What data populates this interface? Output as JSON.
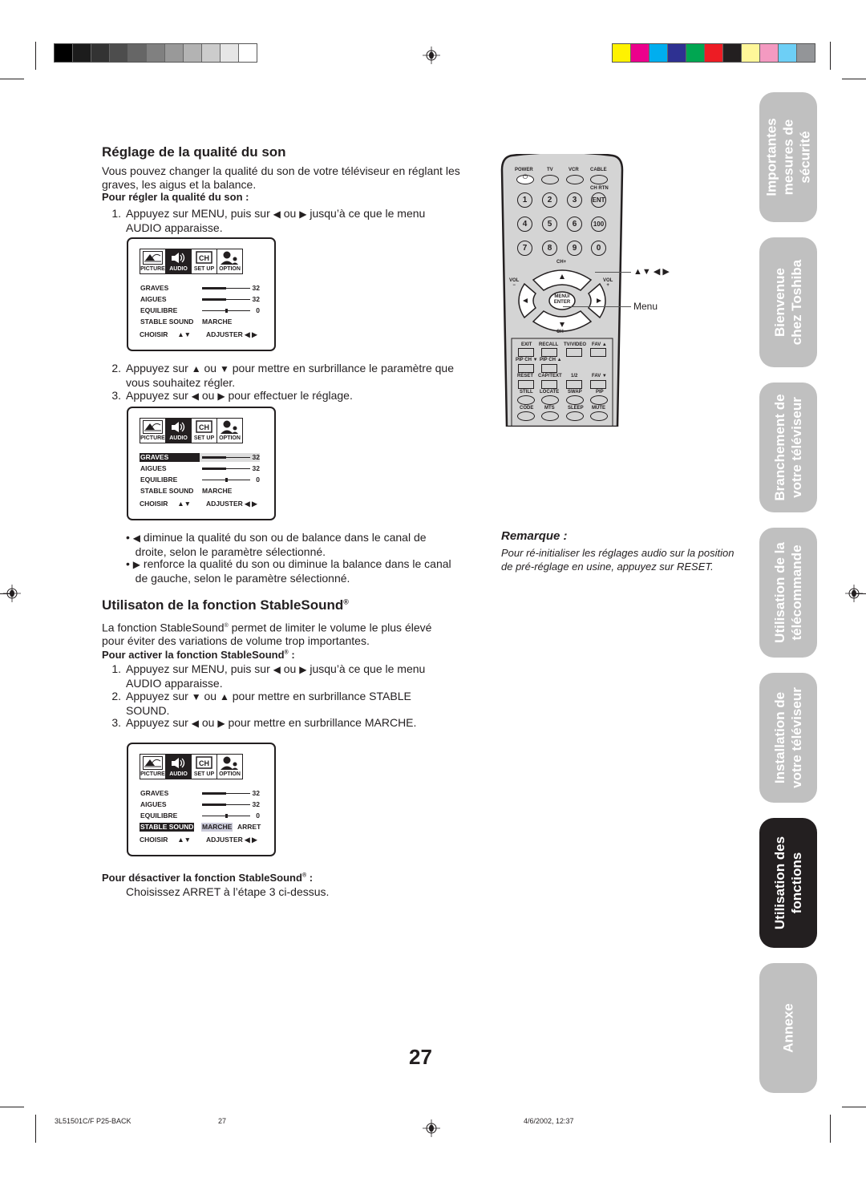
{
  "registration": {
    "grayscale": [
      "#000000",
      "#1c1c1c",
      "#333333",
      "#4d4d4d",
      "#666666",
      "#808080",
      "#999999",
      "#b3b3b3",
      "#cccccc",
      "#e6e6e6",
      "#ffffff"
    ],
    "colors": [
      "#fff200",
      "#ec008c",
      "#00aeef",
      "#2e3192",
      "#00a651",
      "#ed1c24",
      "#231f20",
      "#fff799",
      "#f49ac1",
      "#6dcff6",
      "#939598"
    ]
  },
  "section1": {
    "title": "Réglage de la qualité du son",
    "intro": "Vous pouvez changer la qualité du son de votre téléviseur  en réglant les graves, les aigus et la balance.",
    "subhead": "Pour régler la qualité du son :",
    "step1": {
      "num": "1.",
      "a": "Appuyez sur MENU, puis sur",
      "ou": "ou",
      "b": "jusqu’à ce que le menu",
      "c": "AUDIO apparaisse."
    },
    "step2": {
      "num": "2.",
      "a": "Appuyez sur",
      "ou": "ou",
      "b": "pour mettre en surbrillance le paramètre que",
      "c": "vous souhaitez régler."
    },
    "step3": {
      "num": "3.",
      "a": "Appuyez sur",
      "ou": "ou",
      "b": "pour effectuer le réglage."
    },
    "bullet1": {
      "a": "diminue la qualité du son ou de balance dans le canal de",
      "b": "droite, selon le paramètre sélectionné."
    },
    "bullet2": {
      "a": "renforce la qualité du son ou diminue la balance dans le canal",
      "b": "de gauche, selon le paramètre sélectionné."
    }
  },
  "section2": {
    "title": "Utilisaton de la fonction StableSound",
    "reg_mark": "®",
    "intro_a": "La fonction StableSound",
    "intro_b": " permet de limiter le volume le plus élevé",
    "intro_c": "pour éviter des variations de volume trop importantes.",
    "subhead": "Pour activer la fonction StableSound",
    "subhead_colon": " :",
    "step1": {
      "num": "1.",
      "a": "Appuyez sur MENU, puis sur",
      "ou": "ou",
      "b": "jusqu’à ce que le menu",
      "c": "AUDIO apparaisse."
    },
    "step2": {
      "num": "2.",
      "a": "Appuyez sur ",
      "ou": "ou",
      "b": "pour mettre en surbrillance STABLE",
      "c": "SOUND."
    },
    "step3": {
      "num": "3.",
      "a": "Appuyez sur",
      "ou": "ou",
      "b": "pour mettre en surbrillance MARCHE."
    },
    "deact_head": "Pour désactiver la fonction StableSound",
    "deact_colon": " :",
    "deact_text": "Choisissez ARRET à l’étape 3 ci-dessus."
  },
  "osd": {
    "tabs": [
      "PICTURE",
      "AUDIO",
      "SET UP",
      "OPTION"
    ],
    "ch_label": "CH",
    "rows": [
      {
        "name": "GRAVES",
        "value": "32",
        "level": 0.5
      },
      {
        "name": "AIGUES",
        "value": "32",
        "level": 0.5
      },
      {
        "name": "EQUILIBRE",
        "value": "0",
        "level": 0.5
      }
    ],
    "stable_label": "STABLE SOUND",
    "stable_on": "MARCHE",
    "stable_off": "ARRET",
    "footer_select": "CHOISIR",
    "footer_adjust": "ADJUSTER"
  },
  "arrows": {
    "up": "▲",
    "down": "▼",
    "left": "◀",
    "right": "▶"
  },
  "remote": {
    "top_labels": [
      "POWER",
      "TV",
      "VCR",
      "CABLE"
    ],
    "ch_rtn": "CH RTN",
    "numbers": [
      "1",
      "2",
      "3",
      "ENT",
      "4",
      "5",
      "6",
      "100",
      "7",
      "8",
      "9",
      "0"
    ],
    "ch_plus": "CH+",
    "ch_minus": "CH−",
    "vol_minus": "VOL\n−",
    "vol_plus": "VOL\n+",
    "menu_enter": "MENU/\nENTER",
    "row1": [
      "EXIT",
      "RECALL",
      "TV/VIDEO",
      "FAV ▲"
    ],
    "row2": [
      "PIP CH ▼",
      "PIP CH ▲"
    ],
    "row3": [
      "RESET",
      "CAP/TEXT",
      "1/2",
      "FAV ▼"
    ],
    "row4": [
      "STILL",
      "LOCATE",
      "SWAP",
      "PIP"
    ],
    "row5": [
      "CODE",
      "MTS",
      "SLEEP",
      "MUTE"
    ],
    "callout_arrows": "▲▼ ◀ ▶",
    "callout_menu": "Menu"
  },
  "note": {
    "title": "Remarque :",
    "text": "Pour ré-initialiser les réglages audio sur la position de pré-réglage en usine, appuyez sur RESET."
  },
  "side_tabs": [
    {
      "line1": "Importantes",
      "line2": "mesures de",
      "line3": "sécurité",
      "active": false
    },
    {
      "line1": "Bienvenue",
      "line2": "chez Toshiba",
      "active": false
    },
    {
      "line1": "Branchement de",
      "line2": "votre téléviseur",
      "active": false
    },
    {
      "line1": "Utilisation de la",
      "line2": "télécommande",
      "active": false
    },
    {
      "line1": "Installation de",
      "line2": "votre téléviseur",
      "active": false
    },
    {
      "line1": "Utilisation des",
      "line2": "fonctions",
      "active": true
    },
    {
      "line1": "Annexe",
      "active": false
    }
  ],
  "page_number": "27",
  "footer": {
    "file": "3L51501C/F P25-BACK",
    "page": "27",
    "date": "4/6/2002, 12:37"
  }
}
